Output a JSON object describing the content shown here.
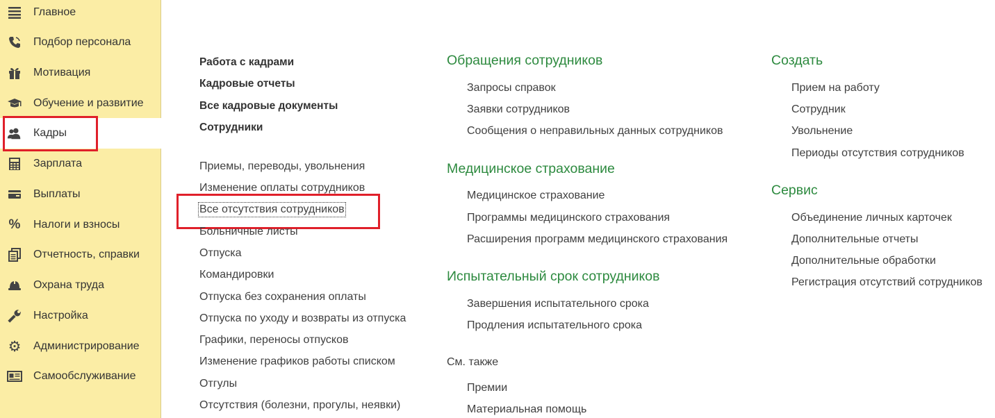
{
  "sidebar": {
    "items": [
      {
        "label": "Главное",
        "icon": "menu-lines-icon"
      },
      {
        "label": "Подбор персонала",
        "icon": "phone-icon"
      },
      {
        "label": "Мотивация",
        "icon": "gift-icon"
      },
      {
        "label": "Обучение и развитие",
        "icon": "graduation-cap-icon"
      },
      {
        "label": "Кадры",
        "icon": "people-icon",
        "active": true
      },
      {
        "label": "Зарплата",
        "icon": "calculator-icon"
      },
      {
        "label": "Выплаты",
        "icon": "wallet-icon"
      },
      {
        "label": "Налоги и взносы",
        "icon": "percent-icon"
      },
      {
        "label": "Отчетность, справки",
        "icon": "documents-icon"
      },
      {
        "label": "Охрана труда",
        "icon": "hard-hat-icon"
      },
      {
        "label": "Настройка",
        "icon": "wrench-icon"
      },
      {
        "label": "Администрирование",
        "icon": "gear-icon"
      },
      {
        "label": "Самообслуживание",
        "icon": "id-card-icon"
      }
    ]
  },
  "col1": {
    "main_links": [
      "Работа с кадрами",
      "Кадровые отчеты",
      "Все кадровые документы",
      "Сотрудники"
    ],
    "links": [
      "Приемы, переводы, увольнения",
      "Изменение оплаты сотрудников",
      "Все отсутствия сотрудников",
      "Больничные листы",
      "Отпуска",
      "Командировки",
      "Отпуска без сохранения оплаты",
      "Отпуска по уходу и возвраты из отпуска",
      "Графики, переносы отпусков",
      "Изменение графиков работы списком",
      "Отгулы",
      "Отсутствия (болезни, прогулы, неявки)"
    ]
  },
  "col2": {
    "sections": [
      {
        "title": "Обращения сотрудников",
        "links": [
          "Запросы справок",
          "Заявки сотрудников",
          "Сообщения о неправильных данных сотрудников"
        ]
      },
      {
        "title": "Медицинское страхование",
        "links": [
          "Медицинское страхование",
          "Программы медицинского страхования",
          "Расширения программ медицинского страхования"
        ]
      },
      {
        "title": "Испытательный срок сотрудников",
        "links": [
          "Завершения испытательного срока",
          "Продления испытательного срока"
        ]
      }
    ],
    "see_also": {
      "title": "См. также",
      "links": [
        "Премии",
        "Материальная помощь"
      ]
    }
  },
  "col3": {
    "sections": [
      {
        "title": "Создать",
        "links": [
          "Прием на работу",
          "Сотрудник",
          "Увольнение",
          "Периоды отсутствия сотрудников"
        ]
      },
      {
        "title": "Сервис",
        "links": [
          "Объединение личных карточек",
          "Дополнительные отчеты",
          "Дополнительные обработки",
          "Регистрация отсутствий сотрудников"
        ]
      }
    ]
  },
  "colors": {
    "sidebar_bg": "#fbeda5",
    "section_title": "#2d8a3f",
    "highlight": "#e0202a"
  }
}
